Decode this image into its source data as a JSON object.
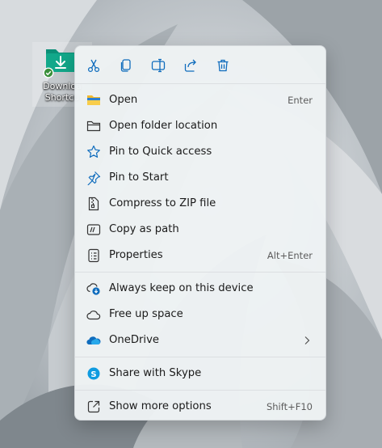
{
  "desktop": {
    "icon_label_line1": "Downloa",
    "icon_label_line2": "Shortcu",
    "icon": "folder-download-icon",
    "status_icon": "checkmark-badge-icon"
  },
  "toolbar": [
    {
      "name": "cut-button",
      "icon": "scissors-icon"
    },
    {
      "name": "copy-button",
      "icon": "copy-icon"
    },
    {
      "name": "rename-button",
      "icon": "rename-icon"
    },
    {
      "name": "share-button",
      "icon": "share-icon"
    },
    {
      "name": "delete-button",
      "icon": "trash-icon"
    }
  ],
  "menu": {
    "open": {
      "label": "Open",
      "shortcut": "Enter",
      "icon": "folder-open-icon"
    },
    "open_location": {
      "label": "Open folder location",
      "icon": "folder-outline-icon"
    },
    "pin_quick": {
      "label": "Pin to Quick access",
      "icon": "star-icon"
    },
    "pin_start": {
      "label": "Pin to Start",
      "icon": "pin-icon"
    },
    "compress": {
      "label": "Compress to ZIP file",
      "icon": "zip-icon"
    },
    "copy_path": {
      "label": "Copy as path",
      "icon": "path-icon"
    },
    "properties": {
      "label": "Properties",
      "shortcut": "Alt+Enter",
      "icon": "properties-icon"
    },
    "keep_device": {
      "label": "Always keep on this device",
      "icon": "cloud-download-icon"
    },
    "free_space": {
      "label": "Free up space",
      "icon": "cloud-icon"
    },
    "onedrive": {
      "label": "OneDrive",
      "icon": "onedrive-icon"
    },
    "skype": {
      "label": "Share with Skype",
      "icon": "skype-icon"
    },
    "more": {
      "label": "Show more options",
      "shortcut": "Shift+F10",
      "icon": "open-external-icon"
    }
  },
  "colors": {
    "accent": "#0f6cbd",
    "menu_bg": "#eef2f4",
    "folder_teal": "#0f9d82"
  }
}
